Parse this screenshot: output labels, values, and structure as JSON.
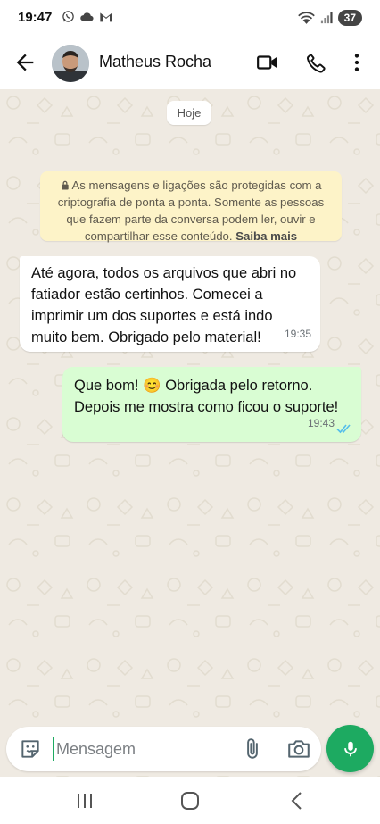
{
  "status_bar": {
    "time": "19:47",
    "battery": "37",
    "left_icons": [
      "whatsapp-icon",
      "cloud-icon",
      "gmail-icon"
    ],
    "right_icons": [
      "wifi-icon",
      "signal-icon",
      "battery-icon"
    ]
  },
  "header": {
    "contact_name": "Matheus Rocha",
    "icons": [
      "back-arrow-icon",
      "video-call-icon",
      "voice-call-icon",
      "more-vert-icon"
    ]
  },
  "chat": {
    "date_chip": "Hoje",
    "encryption": {
      "text": "As mensagens e ligações são protegidas com a criptografia de ponta a ponta. Somente as pessoas que fazem parte da conversa podem ler, ouvir e compartilhar esse conteúdo.",
      "link": "Saiba mais"
    },
    "messages": [
      {
        "direction": "incoming",
        "text": "Até agora, todos os arquivos que abri no fatiador estão certinhos. Comecei a imprimir um dos suportes e está indo muito bem. Obrigado pelo material!",
        "time": "19:35"
      },
      {
        "direction": "outgoing",
        "text_before_emoji": "Que bom!",
        "emoji": "😊",
        "text_after_emoji": "Obrigada pelo retorno. Depois me mostra como ficou o suporte!",
        "time": "19:43",
        "status": "read"
      }
    ]
  },
  "input": {
    "placeholder": "Mensagem",
    "value": "",
    "icons": [
      "sticker-icon",
      "attach-icon",
      "camera-icon",
      "mic-icon"
    ]
  },
  "nav_bar": {
    "icons": [
      "recents-icon",
      "home-icon",
      "back-icon"
    ]
  },
  "colors": {
    "accent_green": "#1daa61",
    "outgoing_bubble": "#d9fdd3",
    "incoming_bubble": "#ffffff",
    "chat_background": "#efeae2",
    "encryption_notice": "#fdf3c8",
    "read_ticks": "#53bdeb"
  }
}
